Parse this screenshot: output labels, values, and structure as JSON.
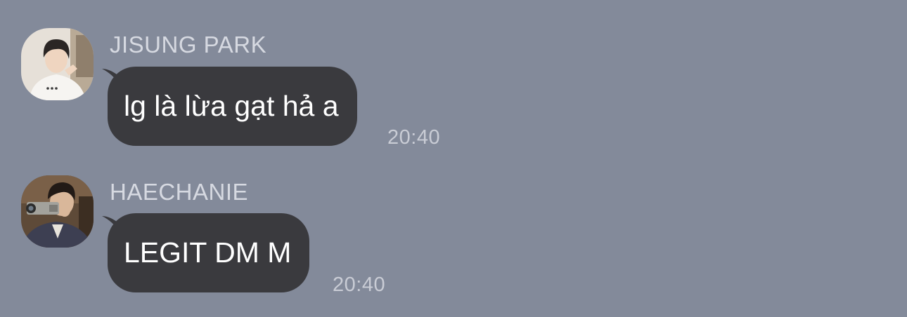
{
  "colors": {
    "background": "#838a9a",
    "bubble": "#3a3a3e",
    "bubble_text": "#ffffff",
    "meta_text": "#d6d9e1"
  },
  "messages": [
    {
      "sender": "JISUNG PARK",
      "text": "lg là lừa gạt hả a",
      "time": "20:40",
      "avatar": "profile-photo-jisung"
    },
    {
      "sender": "HAECHANIE",
      "text": "LEGIT DM M",
      "time": "20:40",
      "avatar": "profile-photo-haechanie"
    }
  ]
}
